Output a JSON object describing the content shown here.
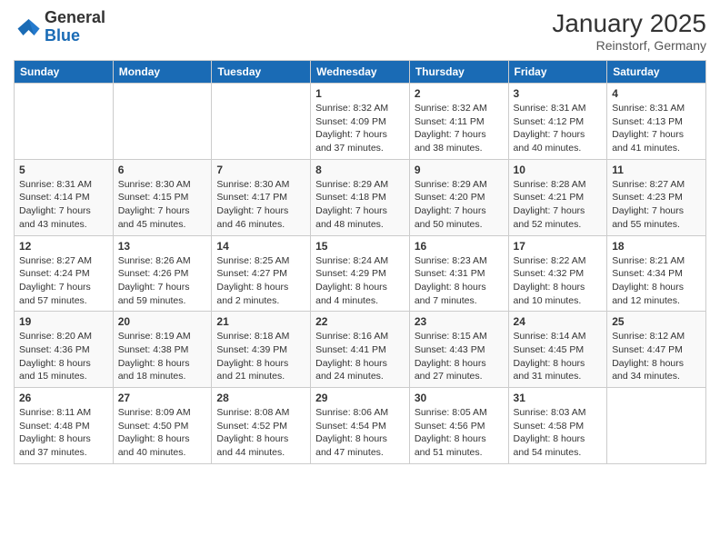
{
  "logo": {
    "general": "General",
    "blue": "Blue"
  },
  "header": {
    "month_year": "January 2025",
    "location": "Reinstorf, Germany"
  },
  "weekdays": [
    "Sunday",
    "Monday",
    "Tuesday",
    "Wednesday",
    "Thursday",
    "Friday",
    "Saturday"
  ],
  "weeks": [
    [
      {
        "day": "",
        "info": ""
      },
      {
        "day": "",
        "info": ""
      },
      {
        "day": "",
        "info": ""
      },
      {
        "day": "1",
        "sunrise": "8:32 AM",
        "sunset": "4:09 PM",
        "daylight": "7 hours and 37 minutes."
      },
      {
        "day": "2",
        "sunrise": "8:32 AM",
        "sunset": "4:11 PM",
        "daylight": "7 hours and 38 minutes."
      },
      {
        "day": "3",
        "sunrise": "8:31 AM",
        "sunset": "4:12 PM",
        "daylight": "7 hours and 40 minutes."
      },
      {
        "day": "4",
        "sunrise": "8:31 AM",
        "sunset": "4:13 PM",
        "daylight": "7 hours and 41 minutes."
      }
    ],
    [
      {
        "day": "5",
        "sunrise": "8:31 AM",
        "sunset": "4:14 PM",
        "daylight": "7 hours and 43 minutes."
      },
      {
        "day": "6",
        "sunrise": "8:30 AM",
        "sunset": "4:15 PM",
        "daylight": "7 hours and 45 minutes."
      },
      {
        "day": "7",
        "sunrise": "8:30 AM",
        "sunset": "4:17 PM",
        "daylight": "7 hours and 46 minutes."
      },
      {
        "day": "8",
        "sunrise": "8:29 AM",
        "sunset": "4:18 PM",
        "daylight": "7 hours and 48 minutes."
      },
      {
        "day": "9",
        "sunrise": "8:29 AM",
        "sunset": "4:20 PM",
        "daylight": "7 hours and 50 minutes."
      },
      {
        "day": "10",
        "sunrise": "8:28 AM",
        "sunset": "4:21 PM",
        "daylight": "7 hours and 52 minutes."
      },
      {
        "day": "11",
        "sunrise": "8:27 AM",
        "sunset": "4:23 PM",
        "daylight": "7 hours and 55 minutes."
      }
    ],
    [
      {
        "day": "12",
        "sunrise": "8:27 AM",
        "sunset": "4:24 PM",
        "daylight": "7 hours and 57 minutes."
      },
      {
        "day": "13",
        "sunrise": "8:26 AM",
        "sunset": "4:26 PM",
        "daylight": "7 hours and 59 minutes."
      },
      {
        "day": "14",
        "sunrise": "8:25 AM",
        "sunset": "4:27 PM",
        "daylight": "8 hours and 2 minutes."
      },
      {
        "day": "15",
        "sunrise": "8:24 AM",
        "sunset": "4:29 PM",
        "daylight": "8 hours and 4 minutes."
      },
      {
        "day": "16",
        "sunrise": "8:23 AM",
        "sunset": "4:31 PM",
        "daylight": "8 hours and 7 minutes."
      },
      {
        "day": "17",
        "sunrise": "8:22 AM",
        "sunset": "4:32 PM",
        "daylight": "8 hours and 10 minutes."
      },
      {
        "day": "18",
        "sunrise": "8:21 AM",
        "sunset": "4:34 PM",
        "daylight": "8 hours and 12 minutes."
      }
    ],
    [
      {
        "day": "19",
        "sunrise": "8:20 AM",
        "sunset": "4:36 PM",
        "daylight": "8 hours and 15 minutes."
      },
      {
        "day": "20",
        "sunrise": "8:19 AM",
        "sunset": "4:38 PM",
        "daylight": "8 hours and 18 minutes."
      },
      {
        "day": "21",
        "sunrise": "8:18 AM",
        "sunset": "4:39 PM",
        "daylight": "8 hours and 21 minutes."
      },
      {
        "day": "22",
        "sunrise": "8:16 AM",
        "sunset": "4:41 PM",
        "daylight": "8 hours and 24 minutes."
      },
      {
        "day": "23",
        "sunrise": "8:15 AM",
        "sunset": "4:43 PM",
        "daylight": "8 hours and 27 minutes."
      },
      {
        "day": "24",
        "sunrise": "8:14 AM",
        "sunset": "4:45 PM",
        "daylight": "8 hours and 31 minutes."
      },
      {
        "day": "25",
        "sunrise": "8:12 AM",
        "sunset": "4:47 PM",
        "daylight": "8 hours and 34 minutes."
      }
    ],
    [
      {
        "day": "26",
        "sunrise": "8:11 AM",
        "sunset": "4:48 PM",
        "daylight": "8 hours and 37 minutes."
      },
      {
        "day": "27",
        "sunrise": "8:09 AM",
        "sunset": "4:50 PM",
        "daylight": "8 hours and 40 minutes."
      },
      {
        "day": "28",
        "sunrise": "8:08 AM",
        "sunset": "4:52 PM",
        "daylight": "8 hours and 44 minutes."
      },
      {
        "day": "29",
        "sunrise": "8:06 AM",
        "sunset": "4:54 PM",
        "daylight": "8 hours and 47 minutes."
      },
      {
        "day": "30",
        "sunrise": "8:05 AM",
        "sunset": "4:56 PM",
        "daylight": "8 hours and 51 minutes."
      },
      {
        "day": "31",
        "sunrise": "8:03 AM",
        "sunset": "4:58 PM",
        "daylight": "8 hours and 54 minutes."
      },
      {
        "day": "",
        "info": ""
      }
    ]
  ]
}
